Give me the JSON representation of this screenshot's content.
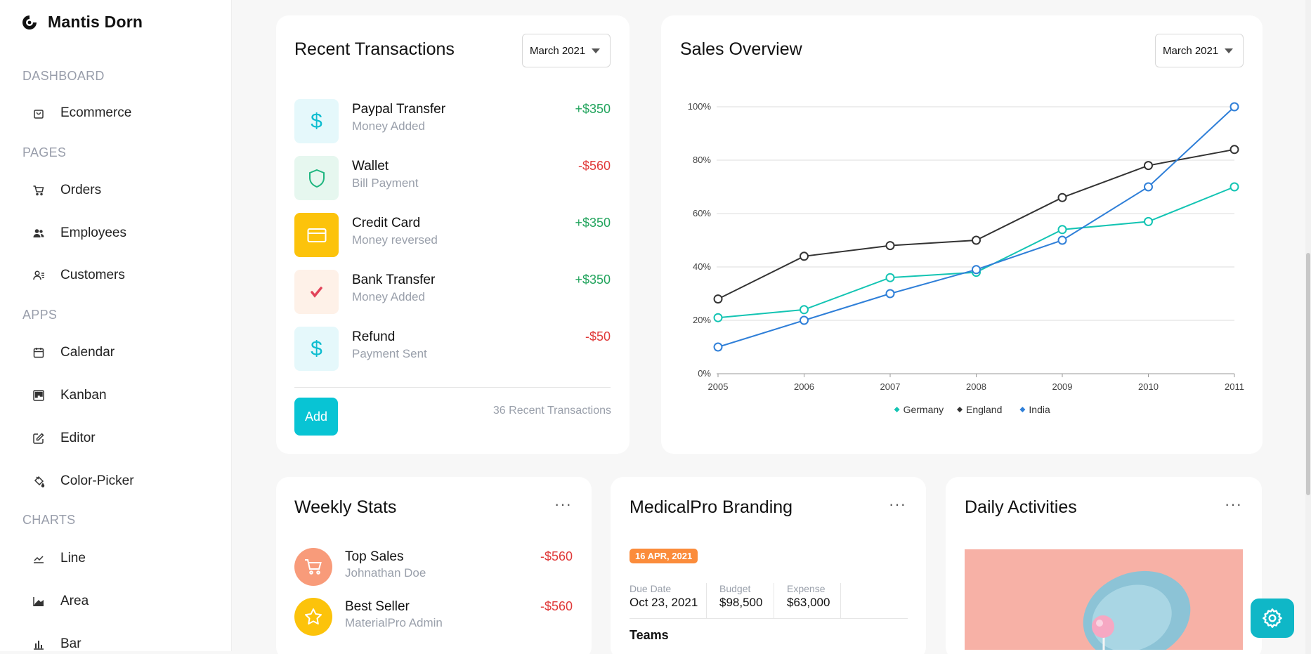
{
  "brand": {
    "name": "Mantis Dorn"
  },
  "sidebar": {
    "sections": [
      {
        "title": "DASHBOARD",
        "items": [
          {
            "label": "Ecommerce",
            "icon": "shopping-bag-icon"
          }
        ]
      },
      {
        "title": "PAGES",
        "items": [
          {
            "label": "Orders",
            "icon": "cart-icon"
          },
          {
            "label": "Employees",
            "icon": "users-icon"
          },
          {
            "label": "Customers",
            "icon": "user-list-icon"
          }
        ]
      },
      {
        "title": "APPS",
        "items": [
          {
            "label": "Calendar",
            "icon": "calendar-icon"
          },
          {
            "label": "Kanban",
            "icon": "kanban-icon"
          },
          {
            "label": "Editor",
            "icon": "edit-icon"
          },
          {
            "label": "Color-Picker",
            "icon": "paint-bucket-icon"
          }
        ]
      },
      {
        "title": "CHARTS",
        "items": [
          {
            "label": "Line",
            "icon": "line-chart-icon"
          },
          {
            "label": "Area",
            "icon": "area-chart-icon"
          },
          {
            "label": "Bar",
            "icon": "bar-chart-icon"
          }
        ]
      }
    ]
  },
  "transactions": {
    "title": "Recent Transactions",
    "month": "March 2021",
    "items": [
      {
        "title": "Paypal Transfer",
        "subtitle": "Money Added",
        "amount": "+$350",
        "positive": true,
        "icon": "dollar-icon"
      },
      {
        "title": "Wallet",
        "subtitle": "Bill Payment",
        "amount": "-$560",
        "positive": false,
        "icon": "shield-icon"
      },
      {
        "title": "Credit Card",
        "subtitle": "Money reversed",
        "amount": "+$350",
        "positive": true,
        "icon": "credit-card-icon"
      },
      {
        "title": "Bank Transfer",
        "subtitle": "Money Added",
        "amount": "+$350",
        "positive": true,
        "icon": "check-icon"
      },
      {
        "title": "Refund",
        "subtitle": "Payment Sent",
        "amount": "-$50",
        "positive": false,
        "icon": "dollar-icon"
      }
    ],
    "add_label": "Add",
    "count_text": "36 Recent Transactions"
  },
  "sales": {
    "title": "Sales Overview",
    "month": "March 2021"
  },
  "chart_data": {
    "type": "line",
    "title": "Sales Overview",
    "x": [
      "2005",
      "2006",
      "2007",
      "2008",
      "2009",
      "2010",
      "2011"
    ],
    "yticks": [
      "0%",
      "20%",
      "40%",
      "60%",
      "80%",
      "100%"
    ],
    "ylim": [
      0,
      100
    ],
    "grid": true,
    "legend": "bottom",
    "series": [
      {
        "name": "Germany",
        "color": "#13c4b3",
        "values": [
          21,
          24,
          36,
          38,
          54,
          57,
          70
        ]
      },
      {
        "name": "England",
        "color": "#333333",
        "values": [
          28,
          44,
          48,
          50,
          66,
          78,
          84
        ]
      },
      {
        "name": "India",
        "color": "#2f7fd8",
        "values": [
          10,
          20,
          30,
          39,
          50,
          70,
          100
        ]
      }
    ]
  },
  "weekly": {
    "title": "Weekly Stats",
    "menu": "···",
    "items": [
      {
        "title": "Top Sales",
        "subtitle": "Johnathan Doe",
        "amount": "-$560",
        "icon": "cart-icon",
        "color": "#f89b7a"
      },
      {
        "title": "Best Seller",
        "subtitle": "MaterialPro Admin",
        "amount": "-$560",
        "icon": "star-icon",
        "color": "#fcc30b"
      }
    ]
  },
  "branding": {
    "title": "MedicalPro Branding",
    "menu": "···",
    "date_badge": "16 APR, 2021",
    "due_label": "Due Date",
    "due_value": "Oct 23, 2021",
    "budget_label": "Budget",
    "budget_value": "$98,500",
    "expense_label": "Expense",
    "expense_value": "$63,000",
    "teams_label": "Teams"
  },
  "daily": {
    "title": "Daily Activities",
    "menu": "···"
  }
}
